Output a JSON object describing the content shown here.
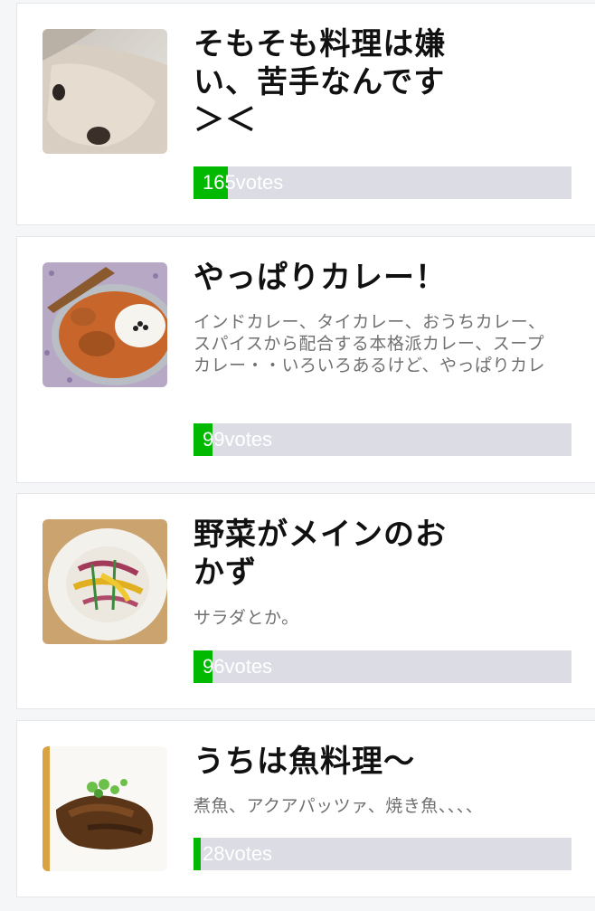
{
  "accent_color": "#00b900",
  "bar_track_color": "#dcdce5",
  "options": [
    {
      "image": "dog-photo",
      "title": "そもそも料理は嫌い、苦手なんです＞＜",
      "description": "",
      "votes": 165,
      "votes_label": "165votes",
      "vote_share": 0.09
    },
    {
      "image": "curry-rice-photo",
      "title": "やっぱりカレー！",
      "description": "インドカレー、タイカレー、おうちカレー、スパイスから配合する本格派カレー、スープカレー・・いろいろあるけど、やっぱりカレ",
      "votes": 99,
      "votes_label": "99votes",
      "vote_share": 0.05
    },
    {
      "image": "vegetable-salad-photo",
      "title": "野菜がメインのおかず",
      "description": "サラダとか。",
      "votes": 96,
      "votes_label": "96votes",
      "vote_share": 0.05
    },
    {
      "image": "simmered-fish-photo",
      "title": "うちは魚料理〜",
      "description": "煮魚、アクアパッツァ、焼き魚、、、、",
      "votes": 28,
      "votes_label": "28votes",
      "vote_share": 0.02
    }
  ]
}
